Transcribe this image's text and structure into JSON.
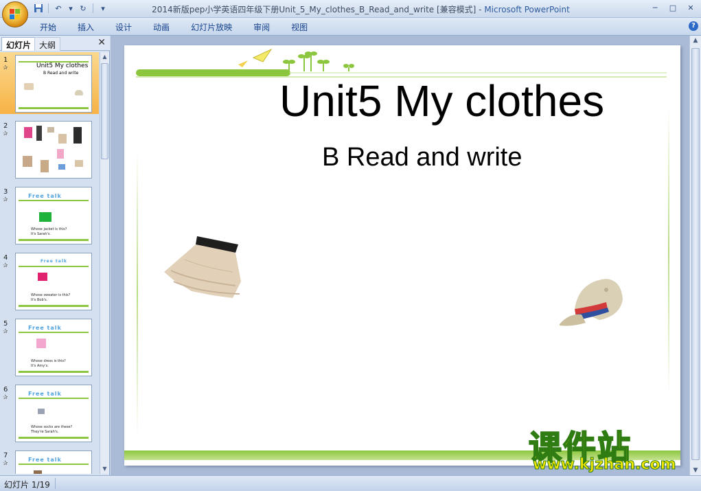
{
  "window": {
    "title": "2014新版pep小学英语四年级下册Unit_5_My_clothes_B_Read_and_write [兼容模式]",
    "title_dash": " - ",
    "app_name": "Microsoft PowerPoint",
    "min_glyph": "─",
    "max_glyph": "□",
    "close_glyph": "✕"
  },
  "quick_access": {
    "save_icon": "save-icon",
    "undo_icon": "undo-icon",
    "redo_icon": "redo-icon",
    "customize_icon": "customize-icon",
    "undo_glyph": "↶",
    "dropdown_glyph": "▾",
    "redo_glyph": "↻",
    "customize_glyph": "▾"
  },
  "ribbon": {
    "tabs": [
      "开始",
      "插入",
      "设计",
      "动画",
      "幻灯片放映",
      "审阅",
      "视图"
    ],
    "help_glyph": "?"
  },
  "left_pane": {
    "tabs": [
      "幻灯片",
      "大纲"
    ],
    "close_glyph": "✕",
    "slides": [
      {
        "num": "1",
        "title": "Unit5 My clothes",
        "sub": "B Read and write"
      },
      {
        "num": "2"
      },
      {
        "num": "3",
        "heading": "Free talk",
        "l1": "Whose jacket is this?",
        "l2": "It's Sarah's."
      },
      {
        "num": "4",
        "heading": "Free talk",
        "l1": "Whose sweater is this?",
        "l2": "It's Bob's."
      },
      {
        "num": "5",
        "heading": "Free talk",
        "l1": "Whose dress is this?",
        "l2": "It's Amy's."
      },
      {
        "num": "6",
        "heading": "Free talk",
        "l1": "Whose socks are these?",
        "l2": "They're Sarah's."
      },
      {
        "num": "7",
        "heading": "Free talk"
      }
    ],
    "star_glyph": "✰",
    "scroll_up": "▲",
    "scroll_down": "▼"
  },
  "slide": {
    "title": "Unit5 My clothes",
    "subtitle": "B Read and write"
  },
  "watermark": {
    "cn": "课件站",
    "url": "www.kjzhan.com"
  },
  "status": {
    "slide_info": "幻灯片 1/19"
  },
  "colors": {
    "accent_green": "#8cc63f",
    "selected_thumb": "#f7b346",
    "app_blue": "#2c5aa0"
  }
}
